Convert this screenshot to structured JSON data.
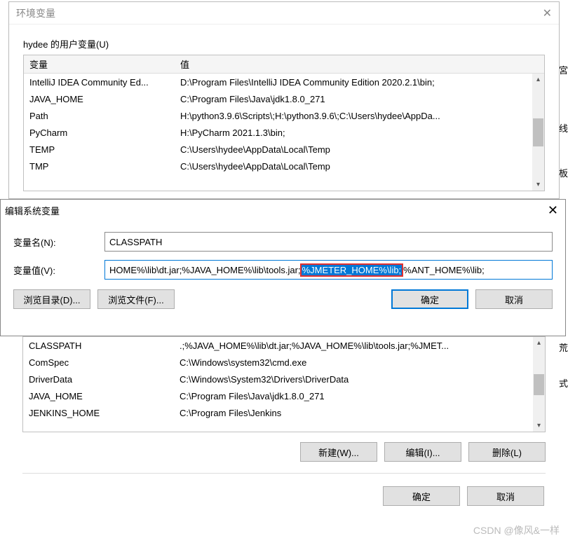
{
  "window": {
    "title": "环境变量",
    "close_icon": "✕"
  },
  "user_vars": {
    "section_title": "hydee 的用户变量(U)",
    "headers": {
      "var": "变量",
      "val": "值"
    },
    "rows": [
      {
        "var": "IntelliJ IDEA Community Ed...",
        "val": "D:\\Program Files\\IntelliJ IDEA Community Edition 2020.2.1\\bin;"
      },
      {
        "var": "JAVA_HOME",
        "val": "C:\\Program Files\\Java\\jdk1.8.0_271"
      },
      {
        "var": "Path",
        "val": "H:\\python3.9.6\\Scripts\\;H:\\python3.9.6\\;C:\\Users\\hydee\\AppDa..."
      },
      {
        "var": "PyCharm",
        "val": "H:\\PyCharm 2021.1.3\\bin;"
      },
      {
        "var": "TEMP",
        "val": "C:\\Users\\hydee\\AppData\\Local\\Temp"
      },
      {
        "var": "TMP",
        "val": "C:\\Users\\hydee\\AppData\\Local\\Temp"
      }
    ]
  },
  "edit_dialog": {
    "title": "编辑系统变量",
    "close_icon": "✕",
    "name_label": "变量名(N):",
    "name_value": "CLASSPATH",
    "value_label": "变量值(V):",
    "value_pre": "HOME%\\lib\\dt.jar;%JAVA_HOME%\\lib\\tools.jar;",
    "value_selected": "%JMETER_HOME%\\lib;",
    "value_post": "%ANT_HOME%\\lib;",
    "browse_dir": "浏览目录(D)...",
    "browse_file": "浏览文件(F)...",
    "ok": "确定",
    "cancel": "取消"
  },
  "sys_vars": {
    "rows": [
      {
        "var": "CLASSPATH",
        "val": ".;%JAVA_HOME%\\lib\\dt.jar;%JAVA_HOME%\\lib\\tools.jar;%JMET..."
      },
      {
        "var": "ComSpec",
        "val": "C:\\Windows\\system32\\cmd.exe"
      },
      {
        "var": "DriverData",
        "val": "C:\\Windows\\System32\\Drivers\\DriverData"
      },
      {
        "var": "JAVA_HOME",
        "val": "C:\\Program Files\\Java\\jdk1.8.0_271"
      },
      {
        "var": "JENKINS_HOME",
        "val": "C:\\Program Files\\Jenkins"
      }
    ],
    "buttons": {
      "new": "新建(W)...",
      "edit": "编辑(I)...",
      "delete": "删除(L)"
    }
  },
  "footer": {
    "ok": "确定",
    "cancel": "取消"
  },
  "side_tabs": {
    "t1": "宮",
    "t2": "线",
    "t3": "板",
    "t4": "荒",
    "t5": "式"
  },
  "watermark": "CSDN @像风&一样"
}
